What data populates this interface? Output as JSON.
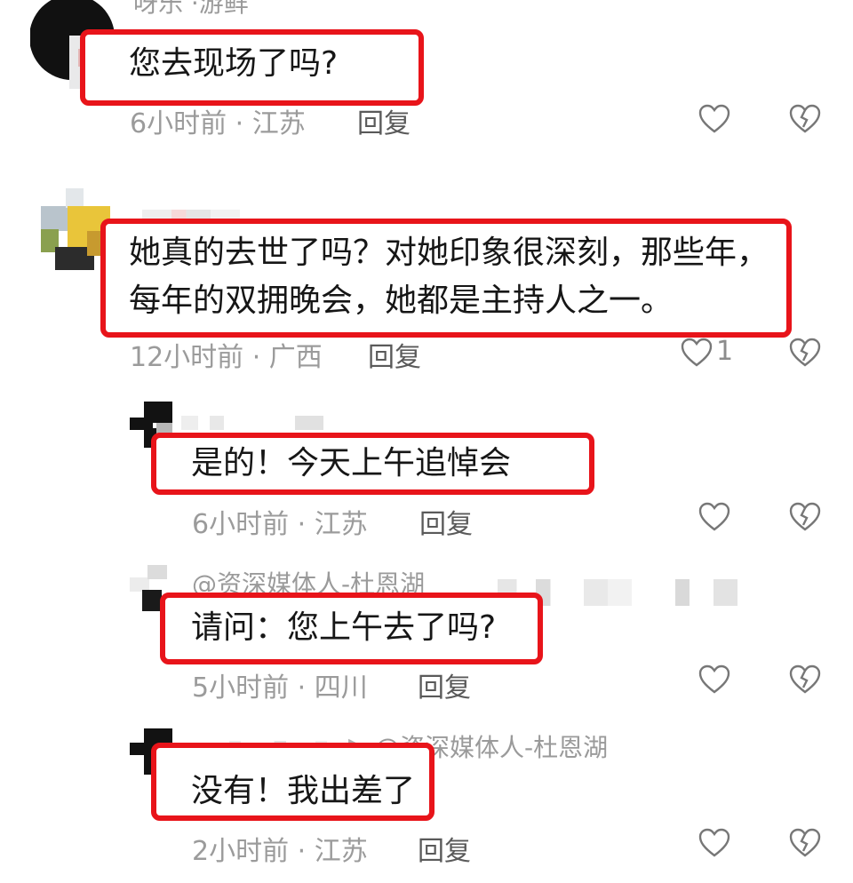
{
  "comments": [
    {
      "username": "呀乐 ·游鲜",
      "text": "您去现场了吗?",
      "time": "6小时前",
      "location": "江苏",
      "reply_label": "回复"
    },
    {
      "text_line1": "她真的去世了吗？对她印象很深刻，那些年，",
      "text_line2": "每年的双拥晚会，她都是主持人之一。",
      "time": "12小时前",
      "location": "广西",
      "reply_label": "回复",
      "like_count": "1"
    },
    {
      "text": "是的！今天上午追悼会",
      "time": "6小时前",
      "location": "江苏",
      "reply_label": "回复"
    },
    {
      "mention": "@资深媒体人-杜恩湖",
      "text": "请问：您上午去了吗?",
      "time": "5小时前",
      "location": "四川",
      "reply_label": "回复"
    },
    {
      "mention": "@资深媒体人-杜恩湖",
      "reply_arrow": "▸",
      "text": "没有！我出差了",
      "time": "2小时前",
      "location": "江苏",
      "reply_label": "回复"
    }
  ],
  "separator": " · ",
  "icons": {
    "like": "heart-outline-icon",
    "dislike": "broken-heart-icon"
  },
  "colors": {
    "highlight": "#e8141a",
    "meta": "#9b9b9b",
    "text": "#161616"
  }
}
